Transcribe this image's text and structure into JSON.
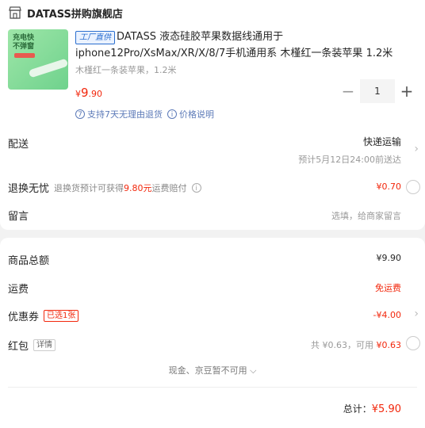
{
  "store": {
    "name": "DATASS拼购旗舰店",
    "icon": "store-icon"
  },
  "product": {
    "thumb_text_1": "充电快",
    "thumb_text_2": "不弹窗",
    "badge": "工厂直供",
    "title": "DATASS 液态硅胶苹果数据线通用于iphone12Pro/XsMax/XR/X/8/7手机通用系 木槿红一条装苹果 1.2米",
    "spec": "木槿红一条装苹果，1.2米",
    "price_symbol": "¥",
    "price_int": "9",
    "price_dec": ".90",
    "quantity": "1",
    "minus": "−",
    "plus": "+",
    "service_return": "支持7天无理由退货",
    "service_price": "价格说明",
    "return_icon": "7",
    "info_icon": "i"
  },
  "delivery": {
    "label": "配送",
    "method": "快递运输",
    "eta": "预计5月12日24:00前送达"
  },
  "worry_free": {
    "label": "退换无忧",
    "desc_prefix": "退换货预计可获得",
    "desc_amount": "9.80元",
    "desc_suffix": "运费赔付",
    "price": "¥0.70"
  },
  "message": {
    "label": "留言",
    "placeholder": "选填，给商家留言"
  },
  "summary": {
    "total_label": "商品总额",
    "total_value": "¥9.90",
    "shipping_label": "运费",
    "shipping_value": "免运费",
    "coupon_label": "优惠券",
    "coupon_badge": "已选1张",
    "coupon_value": "-¥4.00",
    "redpack_label": "红包",
    "redpack_badge": "详情",
    "redpack_total": "共 ¥0.63，可用",
    "redpack_avail": "¥0.63",
    "jd_bean": "现金、京豆暂不可用",
    "grand_label": "总计：",
    "grand_value": "¥5.90"
  },
  "colors": {
    "accent": "#f2270c",
    "link": "#5c7ab8",
    "badge_blue": "#2a6ecf"
  }
}
